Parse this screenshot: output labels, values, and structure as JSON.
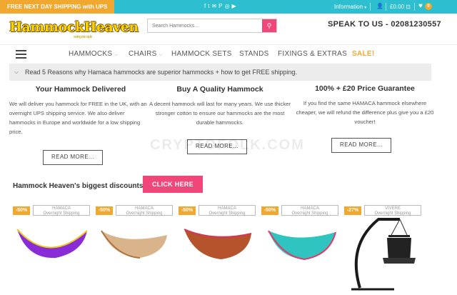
{
  "topbar": {
    "promo": "FREE NEXT DAY SHIPPING with UPS",
    "social_icons": [
      "facebook-icon",
      "twitter-icon",
      "email-icon",
      "pinterest-icon",
      "instagram-icon",
      "youtube-icon"
    ],
    "information": "Information",
    "cart_total": "£0.00",
    "wishlist_count": "0"
  },
  "header": {
    "logo": "HammockHeaven",
    "logo_tagline": "swing into style",
    "search_placeholder": "Search Hammocks...",
    "phone": "SPEAK TO US - 02081230557"
  },
  "nav": {
    "items": [
      "HAMMOCKS",
      "CHAIRS",
      "HAMMOCK SETS",
      "STANDS",
      "FIXINGS & EXTRAS",
      "SALE!"
    ]
  },
  "notice": "Read 5 Reasons why Hamaca hammocks are superior hammocks + how to get FREE shipping.",
  "features": [
    {
      "title": "Your Hammock Delivered",
      "text": "We will deliver you hammock for FREE in the UK, with an overnight UPS shipping service. We also deliver hammocks in Europe and worldwide for a low shipping price.",
      "button": "READ MORE..."
    },
    {
      "title": "Buy A Quality Hammock",
      "text": "A decent hammock will last for many years. We use thicker stronger cotton to ensure our hammocks are the most durable hammocks.",
      "button": "READ MORE..."
    },
    {
      "title": "100% + £20 Price Guarantee",
      "text": "If you find the same HAMACA hammock elsewhere cheaper, we will refund the difference plus give you a £20 voucher!",
      "button": "READ MORE..."
    }
  ],
  "watermark": "CRYPTOFOLK.COM",
  "discounts": {
    "title": "Hammock Heaven's biggest discounts....",
    "button": "CLICK HERE"
  },
  "products": [
    {
      "discount": "-50%",
      "brand": "HAMACA",
      "shipping": "Overnight Shipping",
      "color": "#8a2bd8",
      "edge": "#f0c419"
    },
    {
      "discount": "-50%",
      "brand": "HAMACA",
      "shipping": "Overnight Shipping",
      "color": "#d9b48a",
      "edge": "#b0723f"
    },
    {
      "discount": "-50%",
      "brand": "HAMACA",
      "shipping": "Overnight Shipping",
      "color": "#b5532c",
      "edge": "#d8325a"
    },
    {
      "discount": "-50%",
      "brand": "HAMACA",
      "shipping": "Overnight Shipping",
      "color": "#2fc4c0",
      "edge": "#e23a6a"
    },
    {
      "discount": "-27%",
      "brand": "VIVERE",
      "shipping": "Overnight Shipping",
      "color": "#222222",
      "edge": "#555555"
    }
  ]
}
